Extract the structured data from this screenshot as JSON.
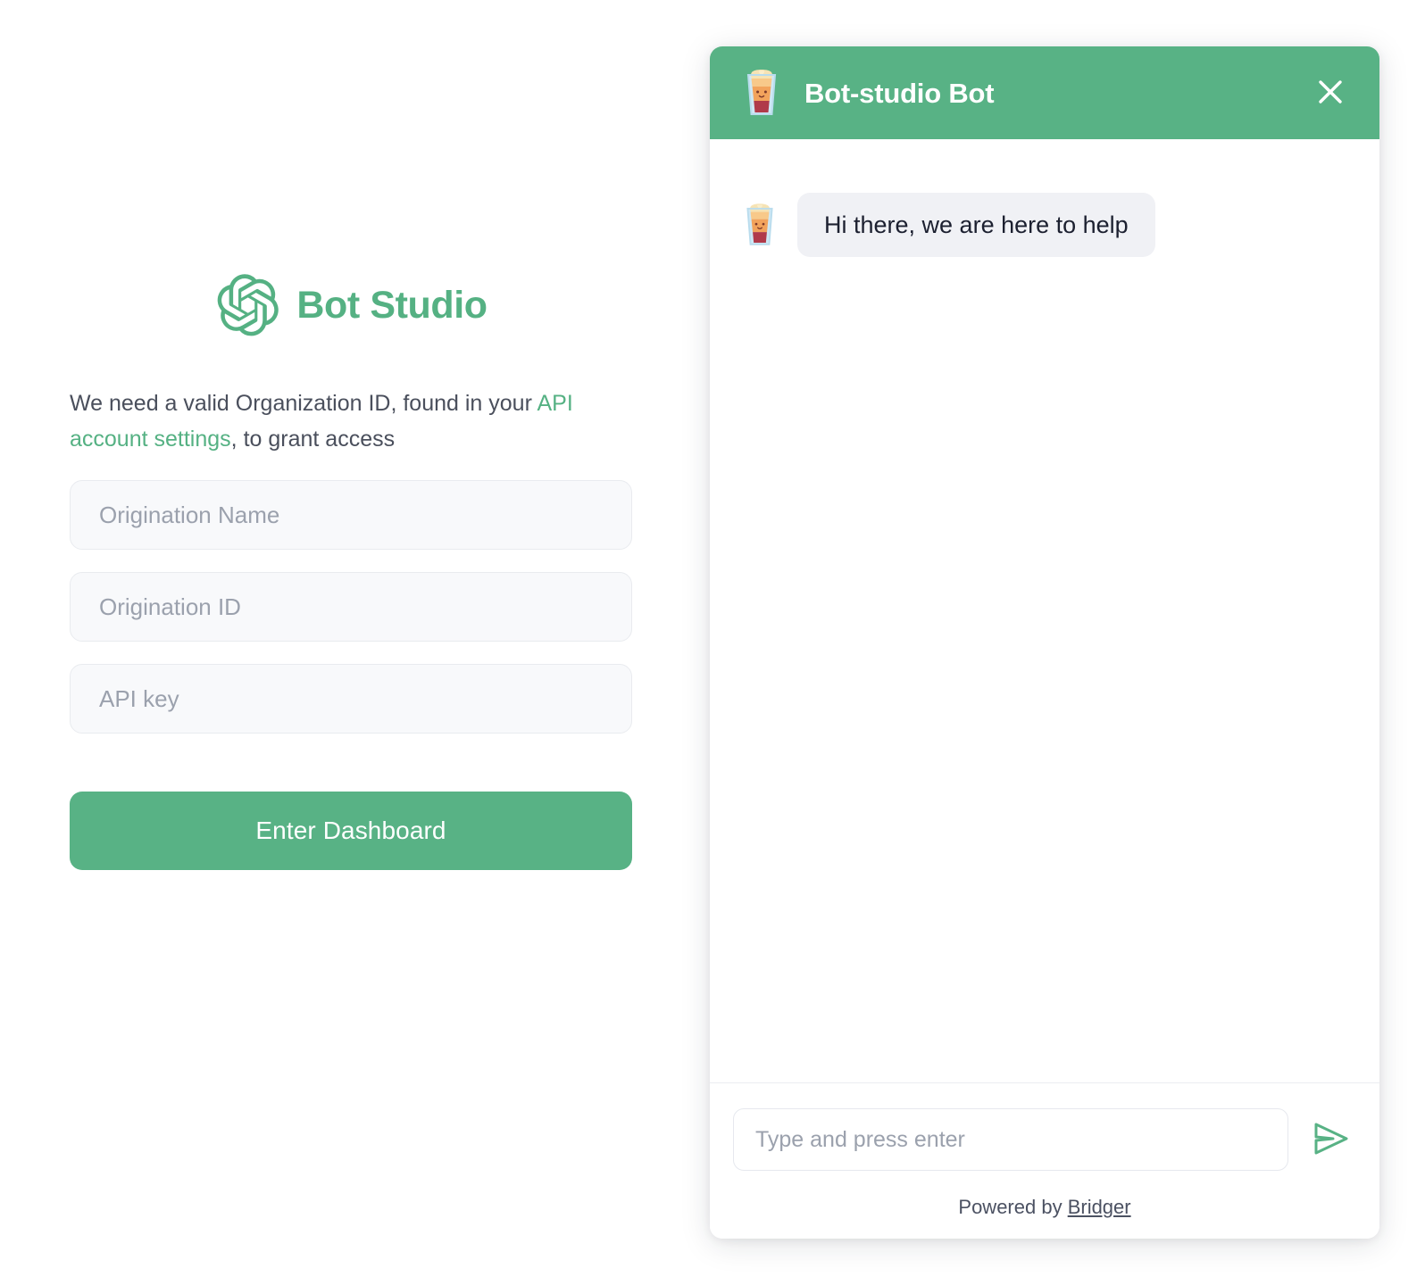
{
  "colors": {
    "brand_green": "#58b285",
    "link_green": "#55b183",
    "bubble_bg": "#f0f1f5",
    "field_bg": "#f8f9fb",
    "text_dark": "#1c2030",
    "text_muted": "#9ba1ad"
  },
  "login": {
    "brand_name": "Bot Studio",
    "logo_icon": "openai-blossom-logo",
    "helper_text_before": "We need a valid Organization ID, found in your ",
    "helper_link": "API account settings",
    "helper_text_after": ", to grant access",
    "fields": [
      {
        "name": "origination-name",
        "placeholder": "Origination Name",
        "value": ""
      },
      {
        "name": "origination-id",
        "placeholder": "Origination ID",
        "value": ""
      },
      {
        "name": "api-key",
        "placeholder": "API key",
        "value": ""
      }
    ],
    "submit_label": "Enter Dashboard"
  },
  "chat": {
    "header": {
      "avatar_icon": "beer-glass-emoji",
      "title": "Bot-studio Bot",
      "close_icon": "close-x-icon"
    },
    "messages": [
      {
        "avatar_icon": "beer-glass-emoji",
        "sender": "bot",
        "text": "Hi there, we are here to help"
      }
    ],
    "composer": {
      "placeholder": "Type and press enter",
      "value": "",
      "send_icon": "send-paper-plane-icon"
    },
    "footer": {
      "prefix": "Powered by ",
      "link": "Bridger"
    }
  }
}
